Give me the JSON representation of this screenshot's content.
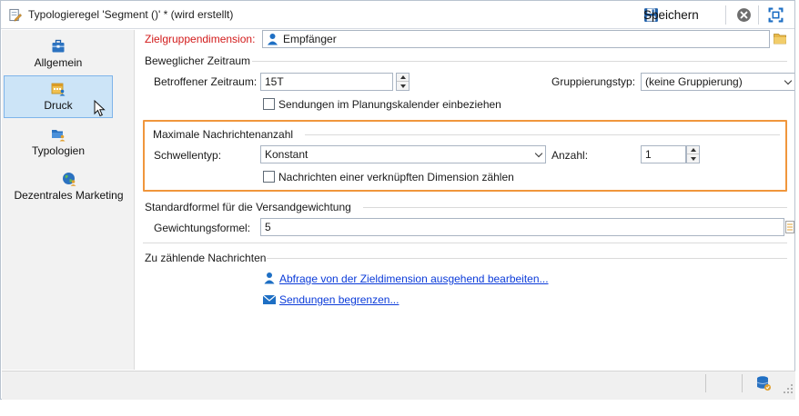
{
  "window": {
    "title": "Typologieregel 'Segment ()' * (wird erstellt)",
    "save_label": "Speichern"
  },
  "sidebar": {
    "items": [
      {
        "label": "Allgemein",
        "icon": "briefcase-icon",
        "active": false
      },
      {
        "label": "Druck",
        "icon": "calendar-user-icon",
        "active": true
      },
      {
        "label": "Typologien",
        "icon": "folder-user-icon",
        "active": false
      },
      {
        "label": "Dezentrales Marketing",
        "icon": "globe-icon",
        "active": false
      }
    ]
  },
  "target": {
    "label": "Zielgruppendimension:",
    "value": "Empfänger"
  },
  "period": {
    "group_title": "Beweglicher Zeitraum",
    "label": "Betroffener Zeitraum:",
    "value": "15T",
    "grouping_label": "Gruppierungstyp:",
    "grouping_value": "(keine Gruppierung)",
    "checkbox_label": "Sendungen im Planungskalender einbeziehen",
    "checkbox_checked": false
  },
  "max_messages": {
    "group_title": "Maximale Nachrichtenanzahl",
    "threshold_label": "Schwellentyp:",
    "threshold_value": "Konstant",
    "count_label": "Anzahl:",
    "count_value": "1",
    "checkbox_label": "Nachrichten einer verknüpften Dimension zählen",
    "checkbox_checked": false
  },
  "weighting": {
    "group_title": "Standardformel für die Versandgewichtung",
    "label": "Gewichtungsformel:",
    "value": "5"
  },
  "count_messages": {
    "group_title": "Zu zählende Nachrichten",
    "link1": "Abfrage von der Zieldimension ausgehend bearbeiten...",
    "link2": "Sendungen begrenzen..."
  },
  "colors": {
    "accent": "#1e6fc4",
    "required_label": "#d21a1a",
    "highlight": "#f0963c",
    "link": "#0b3bd9",
    "sidebar_active": "#cce4f7"
  }
}
